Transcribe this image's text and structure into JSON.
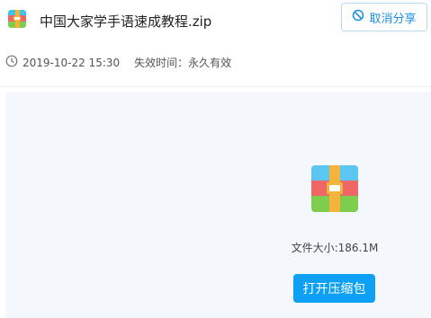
{
  "file": {
    "name": "中国大家学手语速成教程.zip",
    "icon": "zip-archive-icon",
    "size_text": "文件大小:186.1M"
  },
  "actions": {
    "cancel_share_label": "取消分享",
    "cancel_share_icon": "ban-icon",
    "open_archive_label": "打开压缩包"
  },
  "meta": {
    "clock_icon": "clock-icon",
    "share_time": "2019-10-22 15:30",
    "expire_text": "失效时间：永久有效"
  },
  "colors": {
    "accent": "#1c8fe0",
    "primary_button": "#0ea0f5",
    "content_bg": "#f4f7fb"
  }
}
